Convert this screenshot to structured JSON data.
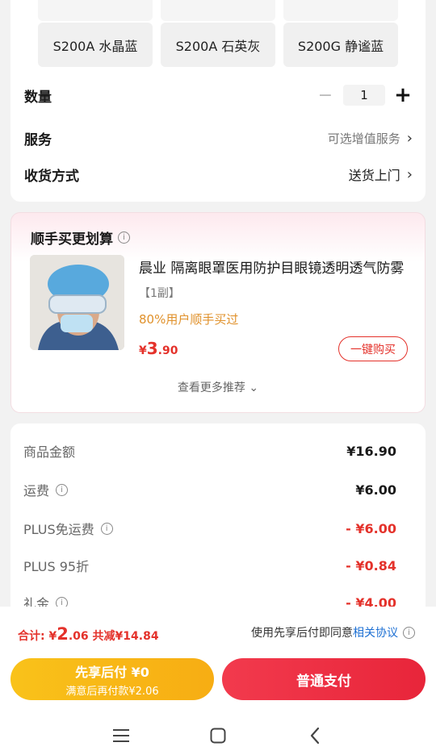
{
  "variants": [
    "S200A 水晶蓝",
    "S200A 石英灰",
    "S200G 静谧蓝"
  ],
  "options": {
    "quantity_label": "数量",
    "quantity_value": "1",
    "minus": "−",
    "plus": "+",
    "service_label": "服务",
    "service_value": "可选增值服务",
    "delivery_label": "收货方式",
    "delivery_value": "送货上门",
    "chevron": "›"
  },
  "recommend": {
    "title": "顺手买更划算",
    "product_name": "晨业 隔离眼罩医用防护目眼镜透明透气防雾",
    "product_spec": "【1副】",
    "product_hint": "80%用户顺手买过",
    "price_currency": "¥",
    "price_int": "3",
    "price_dec": ".90",
    "buy_button": "一键购买",
    "more": "查看更多推荐 ⌄"
  },
  "price_details": {
    "rows": [
      {
        "label": "商品金额",
        "value": "¥16.90",
        "info": false,
        "red": false
      },
      {
        "label": "运费",
        "value": "¥6.00",
        "info": true,
        "red": false
      },
      {
        "label": "PLUS免运费",
        "value": "- ¥6.00",
        "info": true,
        "red": true
      },
      {
        "label": "PLUS 95折",
        "value": "- ¥0.84",
        "info": false,
        "red": true
      },
      {
        "label": "礼金",
        "value": "- ¥4.00",
        "info": true,
        "red": true
      }
    ]
  },
  "bottom": {
    "total_prefix": "合计: ¥",
    "total_int": "2",
    "total_dec": ".06",
    "total_saved": "共减¥14.84",
    "agree_text": "使用先享后付即同意",
    "agree_link": "相关协议",
    "btn_left_title": "先享后付 ¥0",
    "btn_left_sub": "满意后再付款¥2.06",
    "btn_right": "普通支付"
  },
  "colors": {
    "accent_red": "#e4322b",
    "pay_red": "#f23a4d",
    "pay_yellow": "#f9c21a",
    "link_blue": "#1c6fd3",
    "hint_orange": "#e0912b"
  },
  "icons": [
    "info-icon",
    "menu-icon",
    "home-icon",
    "back-icon",
    "chevron-right-icon"
  ]
}
